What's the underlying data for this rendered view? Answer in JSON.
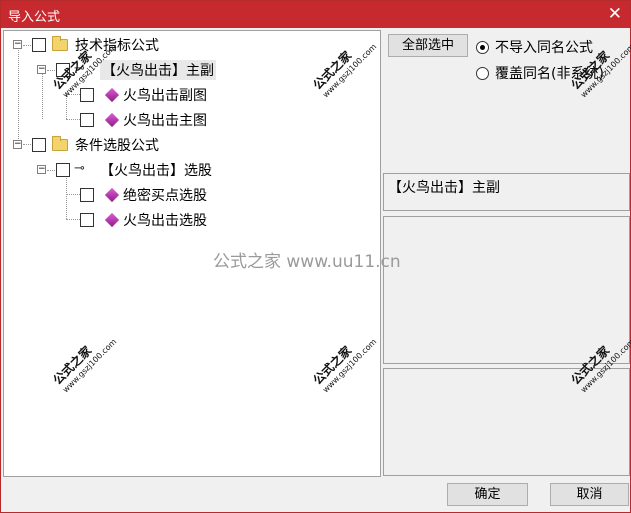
{
  "window": {
    "title": "导入公式",
    "close_glyph": "✕"
  },
  "tree": {
    "nodes": [
      {
        "label": "技术指标公式",
        "expander": "−"
      },
      {
        "label": "【火鸟出击】主副",
        "expander": "−"
      },
      {
        "label": "火鸟出击副图"
      },
      {
        "label": "火鸟出击主图"
      },
      {
        "label": "条件选股公式",
        "expander": "−"
      },
      {
        "label": "【火鸟出击】选股",
        "expander": "−"
      },
      {
        "label": "绝密买点选股"
      },
      {
        "label": "火鸟出击选股"
      }
    ]
  },
  "controls": {
    "select_all": "全部选中",
    "radio_no_import": "不导入同名公式",
    "radio_overwrite": "覆盖同名(非系统)",
    "selected_radio": "radio_no_import"
  },
  "info": {
    "selected_formula": "【火鸟出击】主副"
  },
  "footer": {
    "ok": "确定",
    "cancel": "取消"
  },
  "watermark": {
    "center": "公式之家 www.uu11.cn",
    "stamp": "公式之家",
    "stamp_url": "www.gszj100.com"
  },
  "colors": {
    "titlebar": "#c62a2e",
    "folder": "#f3d36b",
    "gem": "#b23bb0"
  }
}
